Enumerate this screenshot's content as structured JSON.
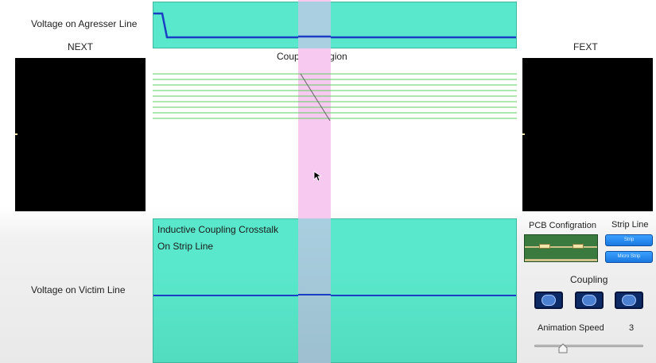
{
  "labels": {
    "aggressor": "Voltage on Agresser Line",
    "next": "NEXT",
    "fext": "FEXT",
    "coupling_region": "Coupling Region",
    "victim": "Voltage on Victim Line"
  },
  "victim_panel": {
    "title_line1": "Inductive Coupling Crosstalk",
    "title_line2": "On Strip Line"
  },
  "controls": {
    "pcb_configuration": "PCB Configration",
    "strip_line": "Strip Line",
    "btn_strip": "Strip",
    "btn_micro": "Micro Strip",
    "coupling_title": "Coupling",
    "coupling_options": [
      "low-coupling",
      "medium-coupling",
      "high-coupling"
    ],
    "animation_speed_label": "Animation Speed",
    "animation_speed_value": "3",
    "animation_speed_fraction": 0.24
  },
  "colors": {
    "waveform_panel": "#5ae8cc",
    "waveform_trace": "#1a3fc4",
    "coupling_band": "#f7c9f0",
    "trace_lines": "#5fcf5f",
    "scope_bg": "#000000"
  }
}
